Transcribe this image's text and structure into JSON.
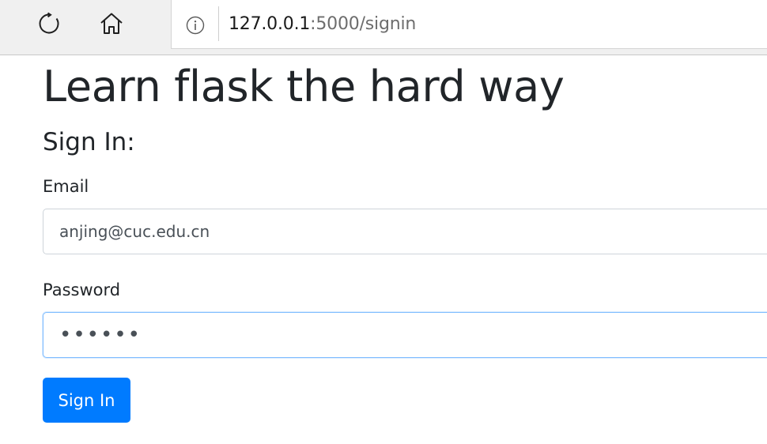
{
  "browser": {
    "url_host": "127.0.0.1",
    "url_path": ":5000/signin"
  },
  "page": {
    "title": "Learn flask the hard way",
    "form_heading": "Sign In:"
  },
  "form": {
    "email_label": "Email",
    "email_value": "anjing@cuc.edu.cn",
    "password_label": "Password",
    "password_value": "123456",
    "submit_label": "Sign In"
  },
  "colors": {
    "primary": "#007bff",
    "focus_border": "#80bdff",
    "input_border": "#ced4da",
    "text": "#212529",
    "toolbar_bg": "#f0f0f0"
  },
  "icons": {
    "reload": "reload-icon",
    "home": "home-icon",
    "info": "info-icon"
  }
}
